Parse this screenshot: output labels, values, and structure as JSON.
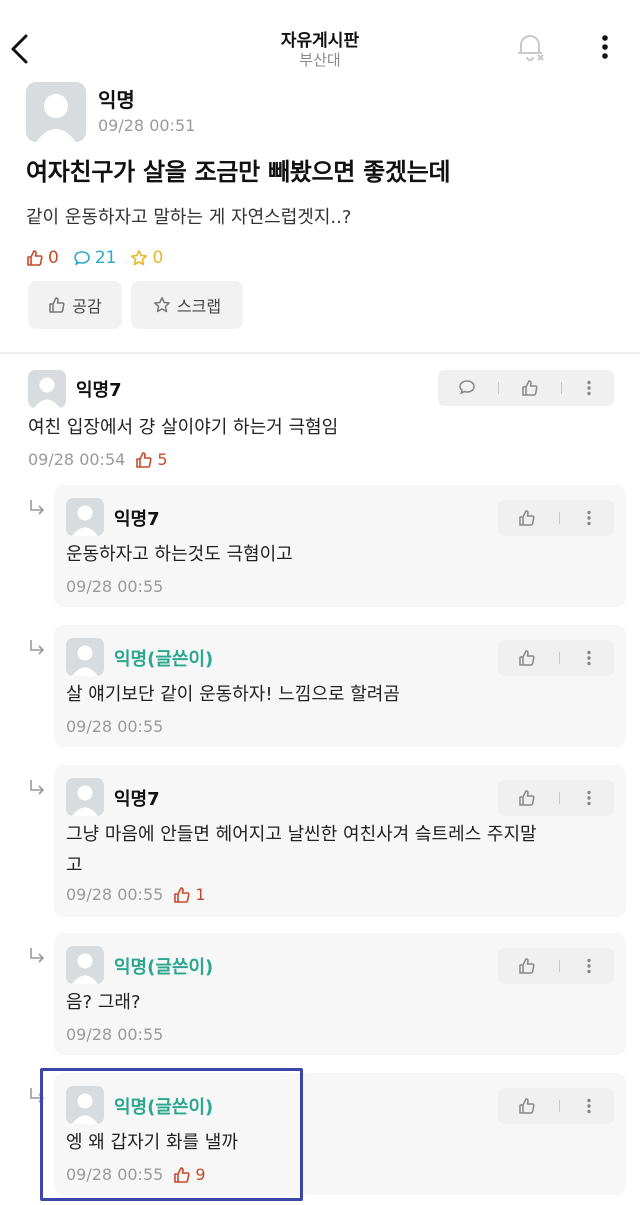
{
  "header": {
    "title": "자유게시판",
    "subtitle": "부산대"
  },
  "post": {
    "author": "익명",
    "date": "09/28 00:51",
    "title": "여자친구가 살을 조금만 빼봤으면 좋겠는데",
    "body": "같이 운동하자고 말하는 게 자연스럽겟지..?",
    "likes": "0",
    "comments": "21",
    "scraps": "0",
    "like_button": "공감",
    "scrap_button": "스크랩"
  },
  "comment": {
    "author": "익명7",
    "text": "여친 입장에서 걍 살이야기 하는거 극혐임",
    "date": "09/28 00:54",
    "likes": "5"
  },
  "replies": [
    {
      "author": "익명7",
      "text": "운동하자고 하는것도 극혐이고",
      "date": "09/28 00:55",
      "likes": ""
    },
    {
      "author": "익명(글쓴이)",
      "text": "살 얘기보단 같이 운동하자! 느낌으로 할려곰",
      "date": "09/28 00:55",
      "likes": ""
    },
    {
      "author": "익명7",
      "text": "그냥 마음에 안들면 헤어지고 날씬한 여친사겨 슼트레스 주지말고",
      "text_line1": "그냥 마음에 안들면 헤어지고 날씬한 여친사겨 슼트레스 주지말",
      "text_line2": "고",
      "date": "09/28 00:55",
      "likes": "1"
    },
    {
      "author": "익명(글쓴이)",
      "text": "음? 그래?",
      "date": "09/28 00:55",
      "likes": ""
    },
    {
      "author": "익명(글쓴이)",
      "text": "엥 왜 갑자기 화를 낼까",
      "date": "09/28 00:55",
      "likes": "9"
    }
  ],
  "colors": {
    "op_name": "#2aa78e",
    "like": "#c44a2c",
    "comment": "#2da8c8",
    "scrap": "#e8b62a",
    "highlight": "#3b46a8"
  },
  "icons": [
    "back-arrow-icon",
    "bell-off-icon",
    "more-vertical-icon",
    "thumbs-up-icon",
    "comment-icon",
    "star-icon",
    "reply-arrow-icon"
  ]
}
